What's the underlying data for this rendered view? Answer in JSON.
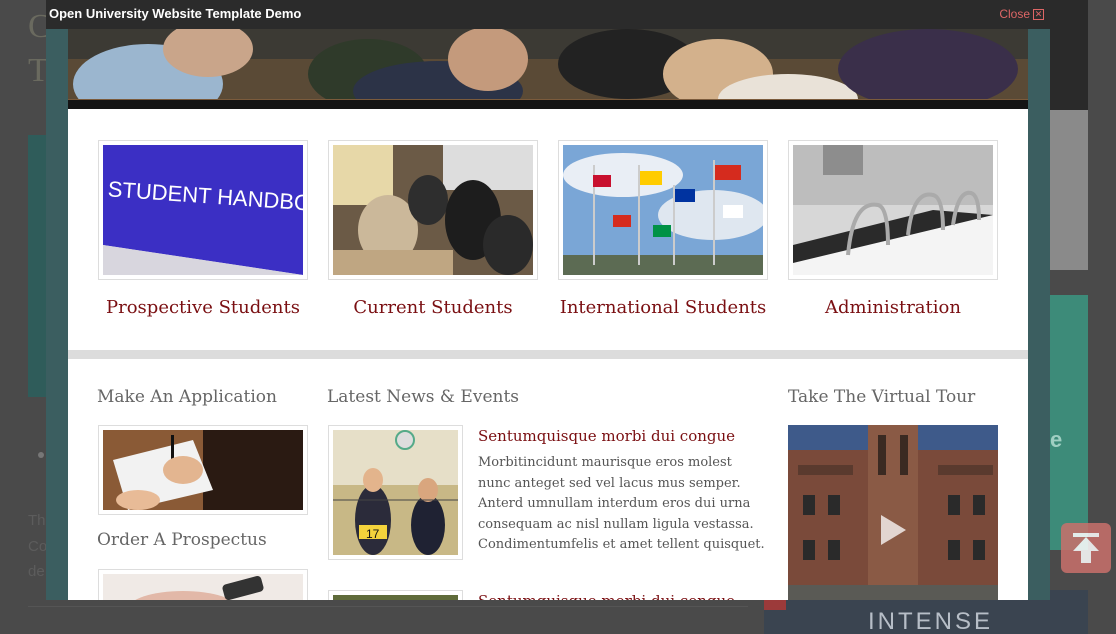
{
  "window": {
    "title": "Open University Website Template Demo",
    "close_label": "Close"
  },
  "background": {
    "title_line1": "C",
    "title_line2": "T",
    "text_lines": [
      "Th",
      "Co",
      "de"
    ],
    "banner_text": "INTENSE",
    "teal_glyph": "e"
  },
  "cards": [
    {
      "label": "Prospective Students",
      "thumb_text": "STUDENT HANDBOOK"
    },
    {
      "label": "Current Students"
    },
    {
      "label": "International Students"
    },
    {
      "label": "Administration"
    }
  ],
  "sections": {
    "apply_heading": "Make An Application",
    "prospectus_heading": "Order A Prospectus",
    "news_heading": "Latest News & Events",
    "tour_heading": "Take The Virtual Tour"
  },
  "news": [
    {
      "title": "Sentumquisque morbi dui congue",
      "body": "Morbitincidunt maurisque eros molest nunc anteget sed vel lacus mus semper. Anterd umnullam interdum eros dui urna consequam ac nisl nullam ligula vestassa. Condimentumfelis et amet tellent quisquet."
    },
    {
      "title": "Sentumquisque morbi dui congue"
    }
  ],
  "colors": {
    "link": "#7a0f12",
    "frame": "#3b5e60",
    "titlebar": "#2b2b2b",
    "close": "#dd6666"
  },
  "icons": {
    "close": "close-icon",
    "play": "play-icon",
    "scroll_top": "arrow-up-icon"
  }
}
